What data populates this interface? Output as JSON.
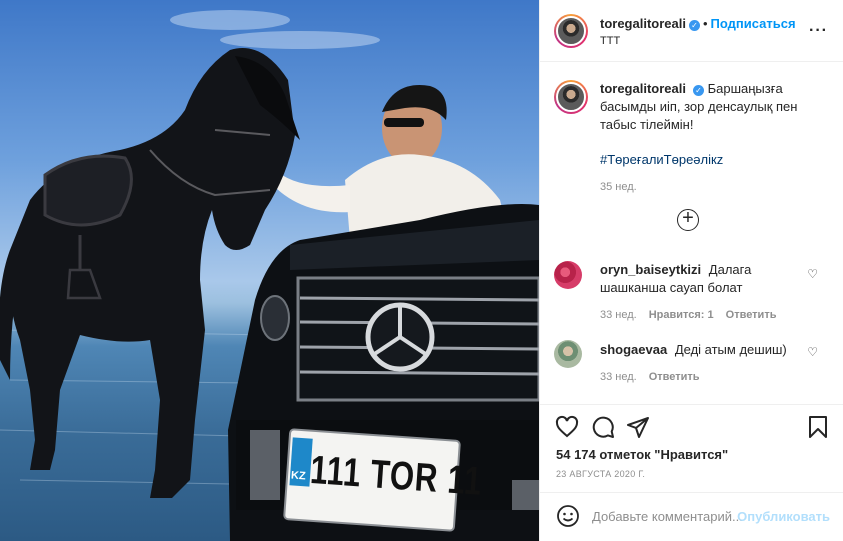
{
  "post": {
    "author": {
      "username": "toregalitoreali",
      "verified": true,
      "follow_label": "Подписаться",
      "location": "TTT"
    },
    "caption": {
      "text": "Баршаңызға басымды иіп, зор денсаулық пен табыс тілеймін!",
      "hashtag": "#ТөреғалиТөреәлікz",
      "time": "35 нед."
    },
    "comments": [
      {
        "username": "oryn_baiseytkizi",
        "text": "Далага шашканша сауап болат",
        "time": "33 нед.",
        "likes": "Нравится: 1",
        "reply": "Ответить"
      },
      {
        "username": "shogaevaa",
        "text": "Деді атым дешиш)",
        "time": "33 нед.",
        "reply": "Ответить"
      }
    ],
    "likes_text": "54 174 отметок \"Нравится\"",
    "date": "23 АВГУСТА 2020 Г.",
    "add_comment": {
      "placeholder": "Добавьте комментарий...",
      "publish": "Опубликовать"
    },
    "photo": {
      "plate_text": "111 TOR 11",
      "plate_region": "KZ"
    }
  },
  "colors": {
    "link_blue": "#0095f6",
    "publish_disabled": "#b2dffc",
    "muted": "#8e8e8e",
    "text": "#262626"
  },
  "icons": [
    "heart-icon",
    "comment-icon",
    "share-icon",
    "bookmark-icon",
    "emoji-icon",
    "plus-circle-icon",
    "more-options-icon",
    "verified-icon"
  ]
}
